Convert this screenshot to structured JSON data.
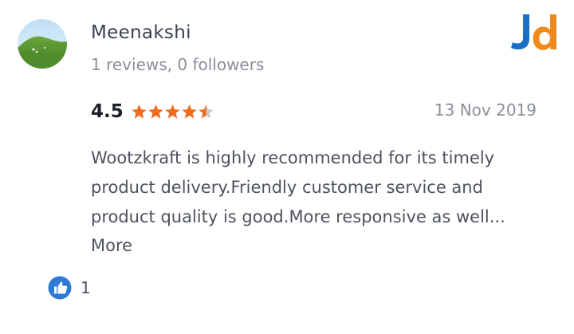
{
  "reviewer": {
    "name": "Meenakshi",
    "stats": "1 reviews, 0 followers"
  },
  "logo": {
    "text_j": "J",
    "text_d": "d",
    "color_j": "#1b6fc4",
    "color_d": "#f08a1b"
  },
  "rating": {
    "value": "4.5",
    "stars": 4.5,
    "max_stars": 5,
    "star_color": "#f26b1d",
    "empty_star_color": "#c8c8c8"
  },
  "date": "13 Nov 2019",
  "review": {
    "lines": [
      "Wootzkraft is highly recommended for its timely",
      "product delivery.Friendly customer service and",
      "product quality is good.More responsive as well..."
    ],
    "more_label": "More"
  },
  "likes": {
    "count": "1",
    "icon": "thumbs-up-icon",
    "icon_color": "#2e79d6"
  }
}
